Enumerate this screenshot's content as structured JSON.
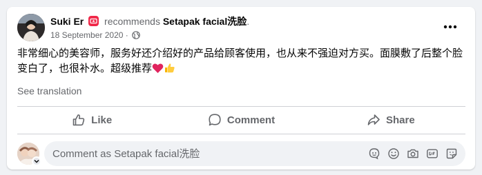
{
  "post": {
    "author": "Suki Er",
    "action_text": "recommends",
    "page_name": "Setapak facial洗脸",
    "punctuation": ".",
    "date": "18 September 2020",
    "separator": "·",
    "body": "非常细心的美容师，服务好还介绍好的产品给顾客使用，也从来不强迫对方买。面膜敷了后整个脸变白了，也很补水。超级推荐",
    "see_translation": "See translation"
  },
  "actions": {
    "like": "Like",
    "comment": "Comment",
    "share": "Share"
  },
  "comment_box": {
    "placeholder": "Comment as Setapak facial洗脸"
  },
  "icons": {
    "recommend_badge": "recommend-icon",
    "globe": "globe-icon",
    "more": "more-options-icon",
    "emojis": [
      "heart-emoji",
      "thumbs-up-emoji"
    ],
    "comment_tools": [
      "avatar-sticker-icon",
      "emoji-icon",
      "camera-icon",
      "gif-icon",
      "sticker-icon"
    ]
  },
  "colors": {
    "recommend": "#f02849",
    "secondary_text": "#65676b",
    "background": "#f0f2f5"
  }
}
